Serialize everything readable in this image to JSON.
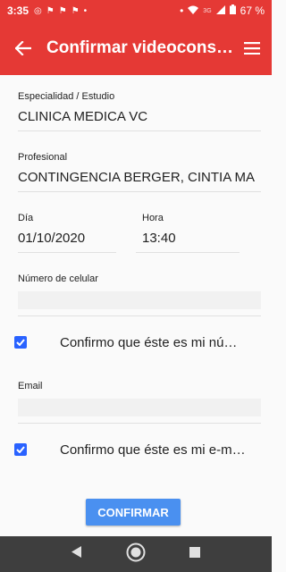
{
  "status": {
    "time": "3:35",
    "battery": "67 %",
    "network": "3G"
  },
  "appbar": {
    "title": "Confirmar videocons…"
  },
  "form": {
    "especialidad_label": "Especialidad / Estudio",
    "especialidad_value": "CLINICA MEDICA VC",
    "profesional_label": "Profesional",
    "profesional_value": "CONTINGENCIA BERGER, CINTIA MA",
    "dia_label": "Día",
    "dia_value": "01/10/2020",
    "hora_label": "Hora",
    "hora_value": "13:40",
    "celular_label": "Número de celular",
    "celular_value": "",
    "confirm_phone_text": "Confirmo que éste es mi nú…",
    "email_label": "Email",
    "email_value": "",
    "confirm_email_text": "Confirmo que éste es mi e-m…",
    "confirm_phone_checked": true,
    "confirm_email_checked": true
  },
  "actions": {
    "confirm_label": "CONFIRMAR"
  },
  "colors": {
    "appbar": "#e53935",
    "checkbox": "#2962ff",
    "button": "#4a90f0"
  }
}
